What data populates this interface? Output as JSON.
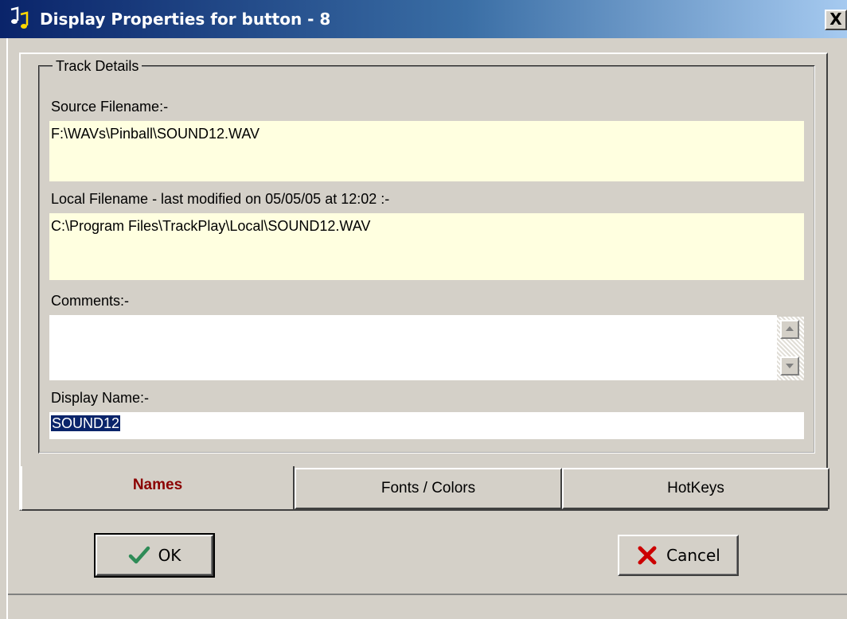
{
  "window": {
    "title": "Display Properties for button - 8",
    "close_label": "X"
  },
  "group": {
    "legend": "Track Details"
  },
  "fields": {
    "source_label": "Source Filename:-",
    "source_value": "F:\\WAVs\\Pinball\\SOUND12.WAV",
    "local_label": "Local Filename - last modified on 05/05/05 at 12:02 :-",
    "local_value": "C:\\Program Files\\TrackPlay\\Local\\SOUND12.WAV",
    "comments_label": "Comments:-",
    "comments_value": "",
    "display_name_label": "Display Name:-",
    "display_name_value": "SOUND12"
  },
  "tabs": [
    {
      "label": "Names",
      "active": true
    },
    {
      "label": "Fonts / Colors",
      "active": false
    },
    {
      "label": "HotKeys",
      "active": false
    }
  ],
  "buttons": {
    "ok_label": "OK",
    "cancel_label": "Cancel"
  },
  "icons": {
    "title_icon": "music-note-icon",
    "ok_icon": "checkmark-icon",
    "cancel_icon": "red-x-icon"
  },
  "colors": {
    "title_bar_start": "#0a246a",
    "readonly_field": "#ffffe0",
    "active_tab_text": "#8b0000",
    "selection": "#0a246a",
    "ok_check": "#2e8b57",
    "cancel_x": "#cc0000"
  }
}
